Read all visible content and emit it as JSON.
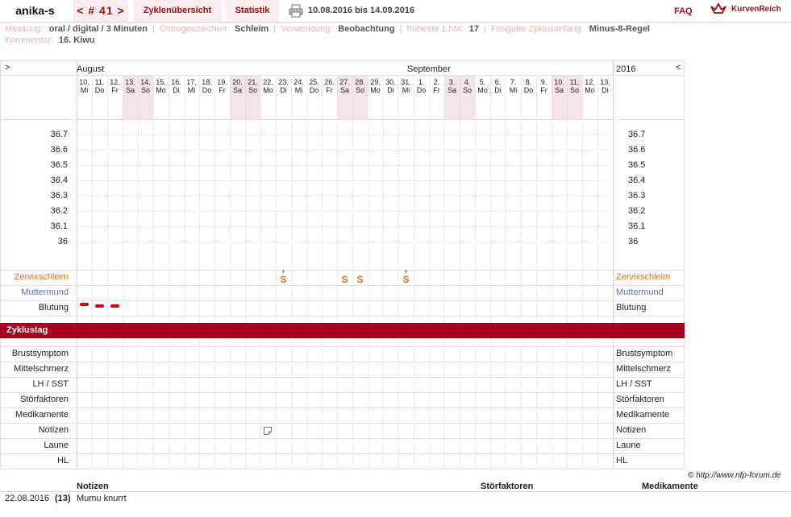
{
  "header": {
    "user": "anika-s",
    "cycle_nav": "< # 41 >",
    "tab_overview": "Zyklenübersicht",
    "tab_stats": "Statistik",
    "date_range": "10.08.2016 bis 14.09.2016",
    "faq": "FAQ",
    "brand": "KurvenReich"
  },
  "info": {
    "messung_label": "Messung:",
    "messung_value": "oral / digital / 3 Minuten",
    "oestrogen_label": "Östrogenzeichen:",
    "oestrogen_value": "Schleim",
    "verwendung_label": "Verwendung:",
    "verwendung_value": "Beobachtung",
    "hm_label": "früheste 1.hM:",
    "hm_value": "17",
    "freigabe_label": "Freigabe Zyklusanfang:",
    "freigabe_value": "Minus-8-Regel",
    "kommentar_label": "Kommentar:",
    "kommentar_value": "16. Kiwu"
  },
  "chart": {
    "nav_left": ">",
    "nav_right": "<",
    "year": "2016",
    "months": [
      {
        "name": "August",
        "start_index": 0
      },
      {
        "name": "September",
        "start_index": 22
      }
    ],
    "dates": [
      {
        "d": "10.",
        "w": "Mi"
      },
      {
        "d": "11.",
        "w": "Do"
      },
      {
        "d": "12.",
        "w": "Fr"
      },
      {
        "d": "13.",
        "w": "Sa"
      },
      {
        "d": "14.",
        "w": "So"
      },
      {
        "d": "15.",
        "w": "Mo"
      },
      {
        "d": "16.",
        "w": "Di"
      },
      {
        "d": "17.",
        "w": "Mi"
      },
      {
        "d": "18.",
        "w": "Do"
      },
      {
        "d": "19.",
        "w": "Fr"
      },
      {
        "d": "20.",
        "w": "Sa"
      },
      {
        "d": "21.",
        "w": "So"
      },
      {
        "d": "22.",
        "w": "Mo"
      },
      {
        "d": "23.",
        "w": "Di"
      },
      {
        "d": "24.",
        "w": "Mi"
      },
      {
        "d": "25.",
        "w": "Do"
      },
      {
        "d": "26.",
        "w": "Fr"
      },
      {
        "d": "27.",
        "w": "Sa"
      },
      {
        "d": "28.",
        "w": "So"
      },
      {
        "d": "29.",
        "w": "Mo"
      },
      {
        "d": "30.",
        "w": "Di"
      },
      {
        "d": "31.",
        "w": "Mi"
      },
      {
        "d": "1.",
        "w": "Do"
      },
      {
        "d": "2.",
        "w": "Fr"
      },
      {
        "d": "3.",
        "w": "Sa"
      },
      {
        "d": "4.",
        "w": "So"
      },
      {
        "d": "5.",
        "w": "Mo"
      },
      {
        "d": "6.",
        "w": "Di"
      },
      {
        "d": "7.",
        "w": "Mi"
      },
      {
        "d": "8.",
        "w": "Do"
      },
      {
        "d": "9.",
        "w": "Fr"
      },
      {
        "d": "10.",
        "w": "Sa"
      },
      {
        "d": "11.",
        "w": "So"
      },
      {
        "d": "12.",
        "w": "Mo"
      },
      {
        "d": "13.",
        "w": "Di"
      }
    ],
    "temps": [
      "36.7",
      "36.6",
      "36.5",
      "36.4",
      "36.3",
      "36.2",
      "36.1",
      "36"
    ],
    "row_zervix": "Zervixschleim",
    "row_muttermund": "Muttermund",
    "row_blutung": "Blutung",
    "row_zyklustag": "Zyklustag",
    "bottom_rows": [
      "Brustsymptom",
      "Mittelschmerz",
      "LH / SST",
      "Störfaktoren",
      "Medikamente",
      "Notizen",
      "Laune",
      "HL"
    ],
    "zervix_marks": [
      {
        "day": 14,
        "symbol": "S",
        "accent": true
      },
      {
        "day": 18,
        "symbol": "S",
        "accent": false
      },
      {
        "day": 19,
        "symbol": "S",
        "accent": false
      },
      {
        "day": 22,
        "symbol": "S",
        "accent": true
      }
    ],
    "bleeding_days": [
      1,
      2,
      3
    ],
    "note_day": 13,
    "colors": {
      "accent": "#a8001e",
      "zervix": "#e07010",
      "muttermund": "#5a6fc9",
      "weekend": "#f3e4e8"
    }
  },
  "footer": {
    "copyright": "© http://www.nfp-forum.de",
    "col_notizen": "Notizen",
    "col_stoer": "Störfaktoren",
    "col_med": "Medikamente",
    "entry_date": "22.08.2016",
    "entry_day": "(13)",
    "entry_note": "Mumu knurrt"
  }
}
